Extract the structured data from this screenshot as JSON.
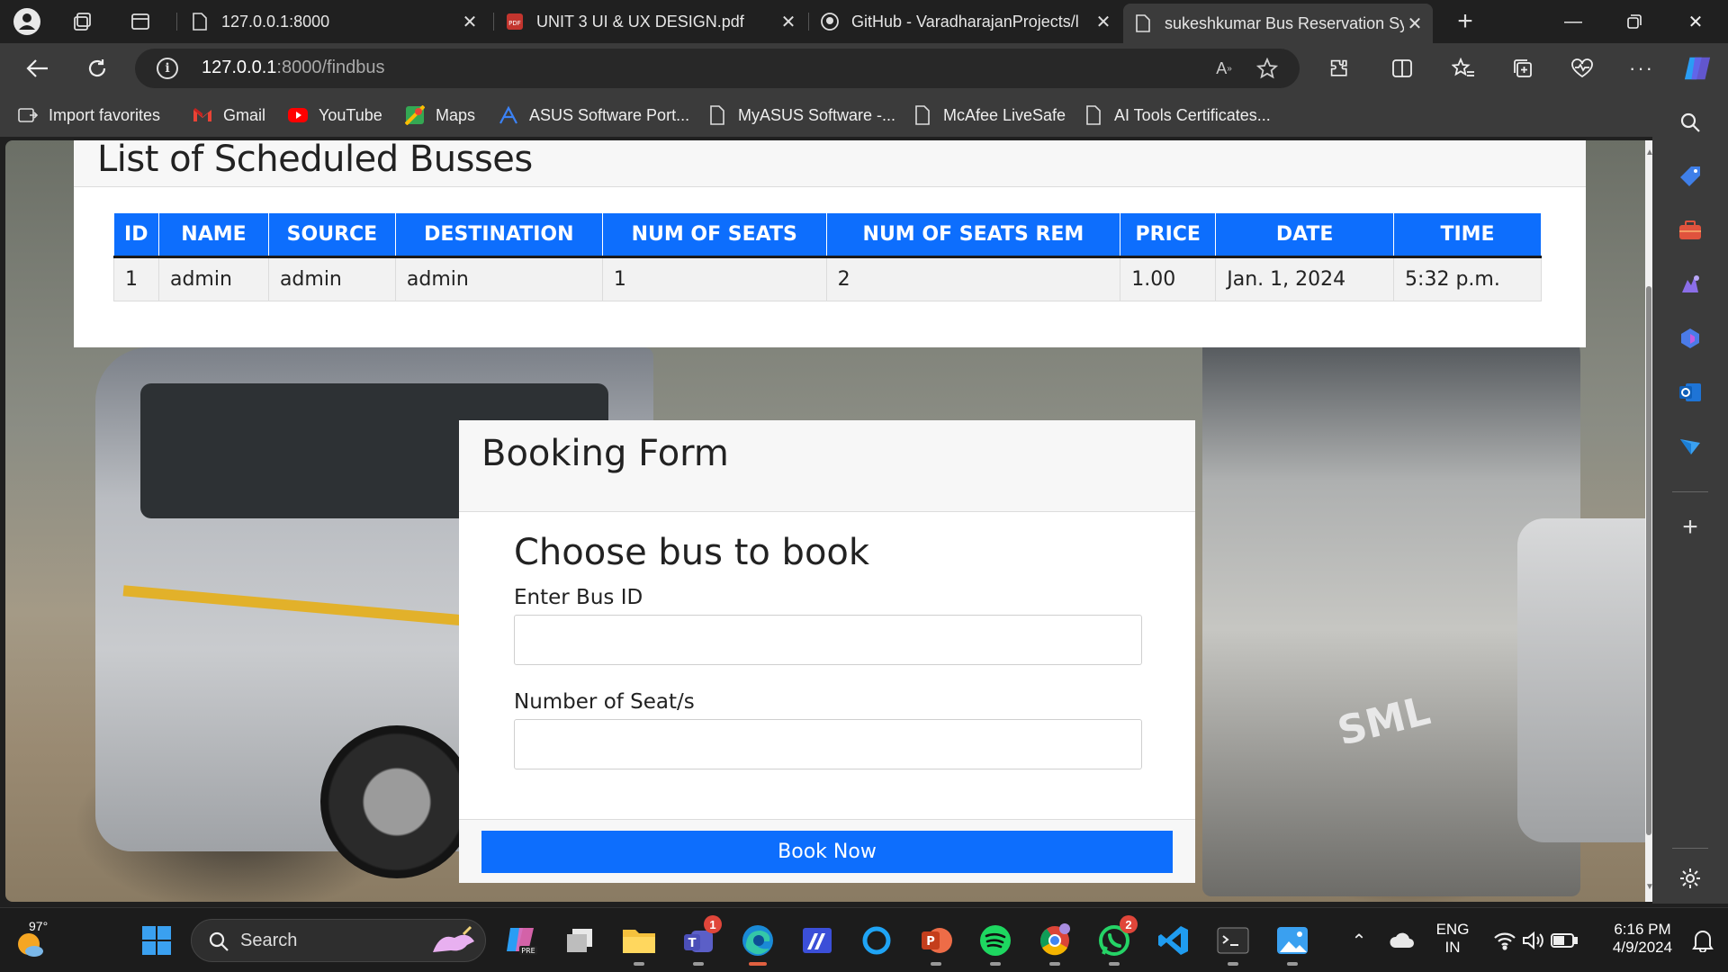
{
  "tabs": [
    {
      "title": "127.0.0.1:8000",
      "active": false
    },
    {
      "title": "UNIT 3 UI & UX DESIGN.pdf",
      "active": false
    },
    {
      "title": "GitHub - VaradharajanProjects/l",
      "active": false
    },
    {
      "title": "sukeshkumar Bus Reservation Sy",
      "active": true
    }
  ],
  "address": {
    "host": "127.0.0.1",
    "rest": ":8000/findbus"
  },
  "bookmarks": [
    {
      "label": "Import favorites",
      "icon": "import-icon"
    },
    {
      "label": "Gmail",
      "icon": "gmail-icon"
    },
    {
      "label": "YouTube",
      "icon": "youtube-icon"
    },
    {
      "label": "Maps",
      "icon": "maps-icon"
    },
    {
      "label": "ASUS Software Port...",
      "icon": "asus-icon"
    },
    {
      "label": "MyASUS Software -...",
      "icon": "page-icon"
    },
    {
      "label": "McAfee LiveSafe",
      "icon": "page-icon"
    },
    {
      "label": "AI Tools Certificates...",
      "icon": "page-icon"
    }
  ],
  "list": {
    "title": "List of Scheduled Busses",
    "columns": [
      "ID",
      "NAME",
      "SOURCE",
      "DESTINATION",
      "NUM OF SEATS",
      "NUM OF SEATS REM",
      "PRICE",
      "DATE",
      "TIME"
    ],
    "rows": [
      [
        "1",
        "admin",
        "admin",
        "admin",
        "1",
        "2",
        "1.00",
        "Jan. 1, 2024",
        "5:32 p.m."
      ]
    ]
  },
  "form": {
    "header": "Booking Form",
    "subtitle": "Choose bus to book",
    "bus_id_label": "Enter Bus ID",
    "bus_id_value": "",
    "seats_label": "Number of Seat/s",
    "seats_value": "",
    "submit": "Book Now"
  },
  "taskbar": {
    "weather_temp": "97°",
    "search_label": "Search",
    "teams_badge": "1",
    "whatsapp_badge": "2",
    "lang_top": "ENG",
    "lang_bottom": "IN",
    "time": "6:16 PM",
    "date": "4/9/2024"
  },
  "colors": {
    "accent": "#0d6efd",
    "chrome_dark": "#202020",
    "chrome": "#3b3b3b"
  }
}
